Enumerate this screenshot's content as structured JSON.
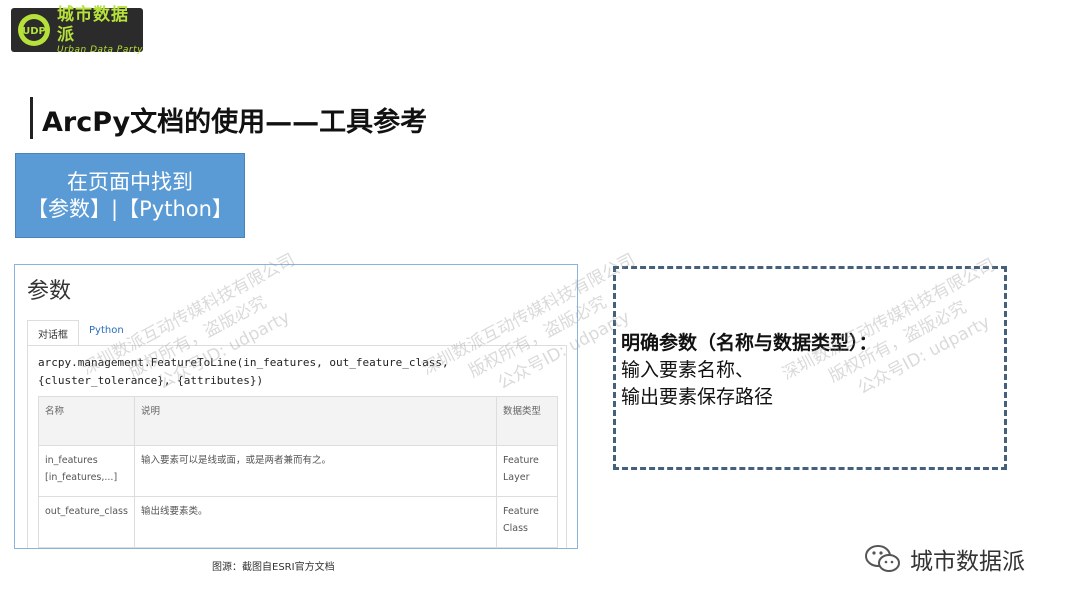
{
  "logo": {
    "name": "城市数据派",
    "tagline": "Urban Data Party",
    "mark_text": "UDP"
  },
  "slide": {
    "title": "ArcPy文档的使用——工具参考",
    "callout_line1": "在页面中找到",
    "callout_line2": "【参数】|【Python】"
  },
  "doc": {
    "heading": "参数",
    "tabs": [
      {
        "label": "对话框",
        "active": true
      },
      {
        "label": "Python",
        "active": false
      }
    ],
    "code_line1": "arcpy.management.FeatureToLine(in_features, out_feature_class,",
    "code_line2": "{cluster_tolerance}, {attributes})",
    "table": {
      "headers": [
        "名称",
        "说明",
        "数据类型"
      ],
      "rows": [
        {
          "name_line1": "in_features",
          "name_line2": "[in_features,...]",
          "desc": "输入要素可以是线或面，或是两者兼而有之。",
          "type_line1": "Feature",
          "type_line2": "Layer"
        },
        {
          "name_line1": "out_feature_class",
          "name_line2": "",
          "desc": "输出线要素类。",
          "type_line1": "Feature",
          "type_line2": "Class"
        }
      ]
    }
  },
  "caption": "图源：截图自ESRI官方文档",
  "note": {
    "heading": "明确参数（名称与数据类型）：",
    "line1": "输入要素名称、",
    "line2": "输出要素保存路径"
  },
  "watermark": {
    "line1": "深圳数派互动传媒科技有限公司",
    "line2": "版权所有，盗版必究",
    "line3": "公众号ID: udparty"
  },
  "footer": {
    "brand": "城市数据派",
    "icon": "wechat-icon"
  },
  "colors": {
    "callout_bg": "#5b9bd5",
    "dashed_border": "#44607a",
    "logo_green": "#b6e03a"
  }
}
